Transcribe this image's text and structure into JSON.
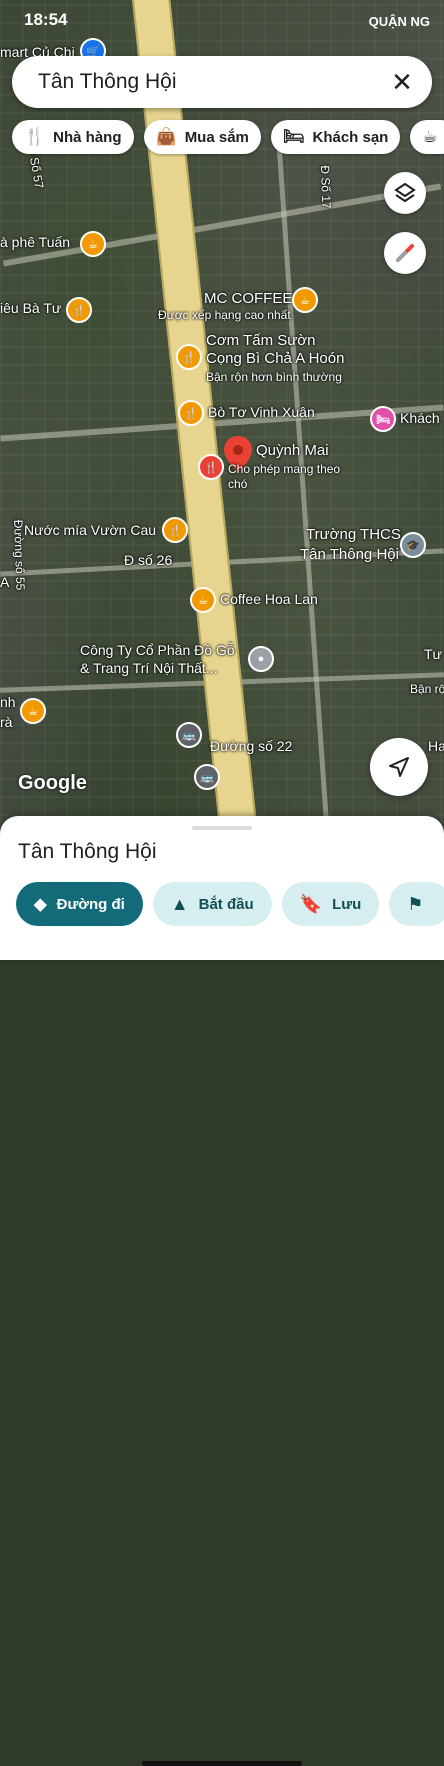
{
  "status": {
    "time": "18:54",
    "right_label": "QUẬN NG"
  },
  "search": {
    "value": "Tân Thông Hội"
  },
  "chips": [
    {
      "label": "Nhà hàng",
      "icon": "fork-knife-icon"
    },
    {
      "label": "Mua sắm",
      "icon": "shopping-bag-icon"
    },
    {
      "label": "Khách sạn",
      "icon": "bed-icon"
    }
  ],
  "map": {
    "labels": {
      "top_left": "mart Củ Chi",
      "cafe_tuan": "à phê Tuấn",
      "lieu_ba_tu": "iêu Bà Tư",
      "mc_coffee": "MC COFFEE",
      "mc_coffee_sub": "Được xếp hạng cao nhất",
      "com_tam_1": "Cơm Tấm Sườn",
      "com_tam_2": "Cọng Bì Chả A Hoón",
      "com_tam_sub": "Bận rộn hơn bình thường",
      "bo_to": "Bò Tơ Vinh Xuân",
      "khach": "Khách",
      "quynh_mai": "Quỳnh Mai",
      "quynh_mai_sub1": "Cho phép mang theo",
      "quynh_mai_sub2": "chó",
      "school_1": "Trường THCS",
      "school_2": "Tân Thông Hội",
      "nuoc_mia": "Nước mía Vườn Cau",
      "d_so_26": "Đ số 26",
      "coffee_hoa_lan": "Coffee Hoa Lan",
      "cong_ty_1": "Công Ty Cổ Phần Đồ Gỗ",
      "cong_ty_2": "& Trang Trí Nội Thất...",
      "duong_so_22": "Đường số 22",
      "d_so_57": "Đ Số 57",
      "d_so_17": "Đ Số 17",
      "duong_so_55": "Đường số 55",
      "ban_ro": "Bận rộ",
      "tu": "Tư",
      "ha": "Ha",
      "nh": "nh",
      "ra": "rà",
      "a": "A"
    },
    "google": "Google"
  },
  "sheet": {
    "title": "Tân Thông Hội",
    "actions": [
      {
        "label": "Đường đi",
        "icon": "directions-icon"
      },
      {
        "label": "Bắt đầu",
        "icon": "navigation-arrow-icon"
      },
      {
        "label": "Lưu",
        "icon": "bookmark-icon"
      }
    ]
  }
}
